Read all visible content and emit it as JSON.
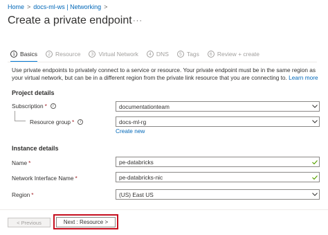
{
  "breadcrumb": {
    "items": [
      "Home",
      "docs-ml-ws | Networking"
    ],
    "separator": ">"
  },
  "page": {
    "title": "Create a private endpoint",
    "more": "···"
  },
  "tabs": [
    {
      "num": "1",
      "label": "Basics",
      "active": true
    },
    {
      "num": "2",
      "label": "Resource",
      "active": false
    },
    {
      "num": "3",
      "label": "Virtual Network",
      "active": false
    },
    {
      "num": "4",
      "label": "DNS",
      "active": false
    },
    {
      "num": "5",
      "label": "Tags",
      "active": false
    },
    {
      "num": "6",
      "label": "Review + create",
      "active": false
    }
  ],
  "description": {
    "text": "Use private endpoints to privately connect to a service or resource. Your private endpoint must be in the same region as your virtual network, but can be in a different region from the private link resource that you are connecting to.",
    "link": "Learn more"
  },
  "project": {
    "heading": "Project details",
    "subscription": {
      "label": "Subscription",
      "required": "*",
      "value": "documentationteam"
    },
    "resource_group": {
      "label": "Resource group",
      "required": "*",
      "value": "docs-ml-rg",
      "create_new": "Create new"
    }
  },
  "instance": {
    "heading": "Instance details",
    "name": {
      "label": "Name",
      "required": "*",
      "value": "pe-databricks"
    },
    "nic_name": {
      "label": "Network Interface Name",
      "required": "*",
      "value": "pe-databricks-nic"
    },
    "region": {
      "label": "Region",
      "required": "*",
      "value": "(US) East US"
    }
  },
  "footer": {
    "previous": "< Previous",
    "next": "Next : Resource >"
  },
  "colors": {
    "accent": "#0078d4",
    "link": "#0067b8",
    "required": "#a4262c",
    "highlight": "#c50f1f",
    "valid": "#57a300"
  }
}
